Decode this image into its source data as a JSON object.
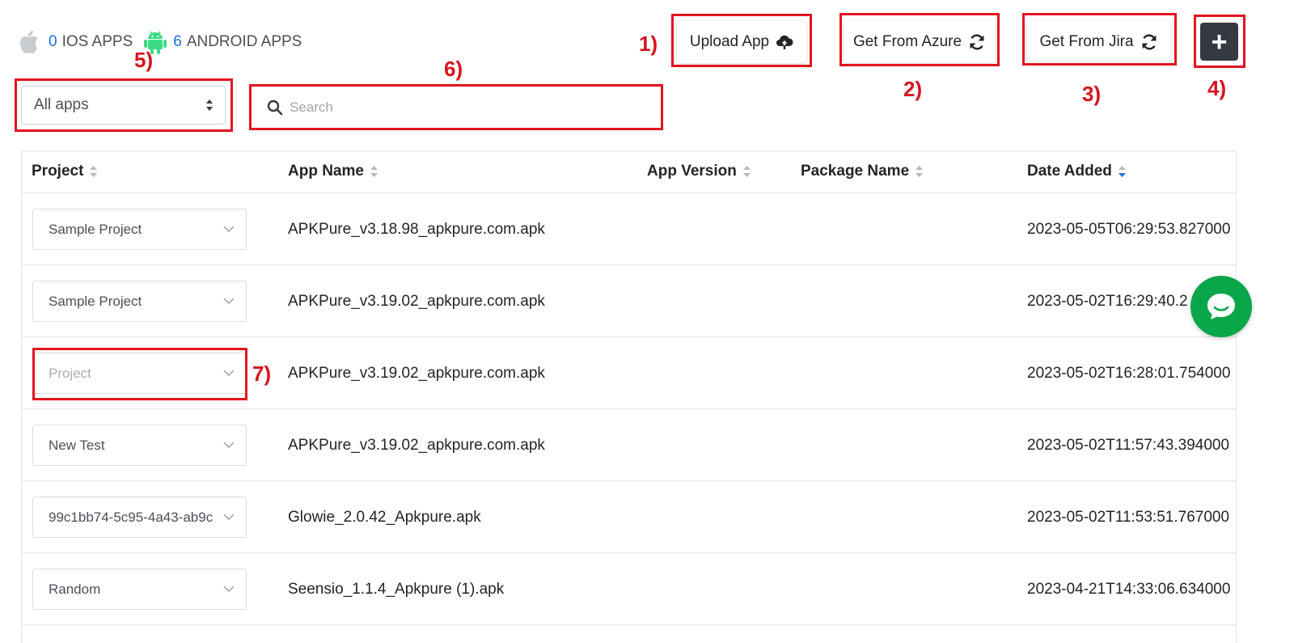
{
  "counts": {
    "ios_count": "0",
    "ios_label": "IOS APPS",
    "android_count": "6",
    "android_label": "ANDROID APPS"
  },
  "toolbar": {
    "upload_label": "Upload App",
    "azure_label": "Get From Azure",
    "jira_label": "Get From Jira",
    "add_label": "+"
  },
  "filter": {
    "selected": "All apps"
  },
  "search": {
    "placeholder": "Search"
  },
  "annotations": [
    "1)",
    "2)",
    "3)",
    "4)",
    "5)",
    "6)",
    "7)"
  ],
  "table": {
    "headers": [
      "Project",
      "App Name",
      "App Version",
      "Package Name",
      "Date Added"
    ],
    "rows": [
      {
        "project": "Sample Project",
        "project_placeholder": false,
        "app_name": "APKPure_v3.18.98_apkpure.com.apk",
        "version": "",
        "package": "",
        "date": "2023-05-05T06:29:53.827000"
      },
      {
        "project": "Sample Project",
        "project_placeholder": false,
        "app_name": "APKPure_v3.19.02_apkpure.com.apk",
        "version": "",
        "package": "",
        "date": "2023-05-02T16:29:40.2"
      },
      {
        "project": "Project",
        "project_placeholder": true,
        "app_name": "APKPure_v3.19.02_apkpure.com.apk",
        "version": "",
        "package": "",
        "date": "2023-05-02T16:28:01.754000"
      },
      {
        "project": "New Test",
        "project_placeholder": false,
        "app_name": "APKPure_v3.19.02_apkpure.com.apk",
        "version": "",
        "package": "",
        "date": "2023-05-02T11:57:43.394000"
      },
      {
        "project": "99c1bb74-5c95-4a43-ab9c",
        "project_placeholder": false,
        "app_name": "Glowie_2.0.42_Apkpure.apk",
        "version": "",
        "package": "",
        "date": "2023-05-02T11:53:51.767000"
      },
      {
        "project": "Random",
        "project_placeholder": false,
        "app_name": "Seensio_1.1.4_Apkpure (1).apk",
        "version": "",
        "package": "",
        "date": "2023-04-21T14:33:06.634000"
      }
    ]
  },
  "colors": {
    "accent": "#1a73e8",
    "annotation_red": "#e3141f",
    "chat_green": "#0aa64a",
    "android_green": "#3ddc84"
  }
}
